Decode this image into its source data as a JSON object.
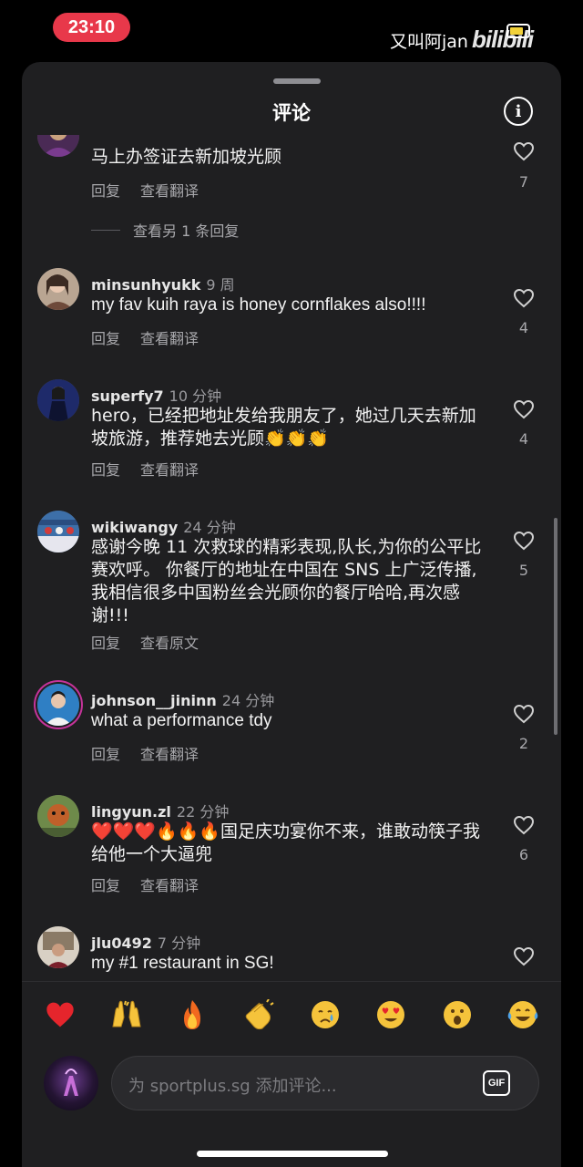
{
  "status": {
    "time": "23:10"
  },
  "watermark": {
    "text": "又叫阿jan",
    "logo": "bilibili"
  },
  "sheet": {
    "title": "评论"
  },
  "comments": [
    {
      "username": "",
      "time": "",
      "text": "马上办签证去新加坡光顾",
      "reply": "回复",
      "translate": "查看翻译",
      "likes": "7",
      "more_replies": "查看另 1 条回复"
    },
    {
      "username": "minsunhyukk",
      "time": "9 周",
      "text": "my fav kuih raya is honey cornflakes also!!!!",
      "reply": "回复",
      "translate": "查看翻译",
      "likes": "4"
    },
    {
      "username": "superfy7",
      "time": "10 分钟",
      "text": "hero，已经把地址发给我朋友了，她过几天去新加坡旅游，推荐她去光顾👏👏👏",
      "reply": "回复",
      "translate": "查看翻译",
      "likes": "4"
    },
    {
      "username": "wikiwangy",
      "time": "24 分钟",
      "text": "感谢今晚 11 次救球的精彩表现,队长,为你的公平比赛欢呼。 你餐厅的地址在中国在 SNS 上广泛传播,我相信很多中国粉丝会光顾你的餐厅哈哈,再次感谢!!!",
      "reply": "回复",
      "translate": "查看原文",
      "likes": "5"
    },
    {
      "username": "johnson__jininn",
      "time": "24 分钟",
      "text": "what a performance tdy",
      "reply": "回复",
      "translate": "查看翻译",
      "likes": "2"
    },
    {
      "username": "lingyun.zl",
      "time": "22 分钟",
      "text": "❤️❤️❤️🔥🔥🔥国足庆功宴你不来，谁敢动筷子我给他一个大逼兜",
      "reply": "回复",
      "translate": "查看翻译",
      "likes": "6"
    },
    {
      "username": "jlu0492",
      "time": "7 分钟",
      "text": "my #1 restaurant in SG!",
      "reply": "",
      "translate": "",
      "likes": ""
    }
  ],
  "emoji_bar": [
    {
      "icon": "red-heart"
    },
    {
      "icon": "raising-hands"
    },
    {
      "icon": "fire"
    },
    {
      "icon": "clapping-hands"
    },
    {
      "icon": "crying-face"
    },
    {
      "icon": "heart-eyes-face"
    },
    {
      "icon": "surprised-face"
    },
    {
      "icon": "tears-of-joy-face"
    }
  ],
  "composer": {
    "placeholder": "为 sportplus.sg 添加评论...",
    "gif_label": "GIF"
  },
  "colors": {
    "status_pill": "#e8384a",
    "sheet_bg": "#1f1f21",
    "muted_text": "#a8a8ac"
  }
}
